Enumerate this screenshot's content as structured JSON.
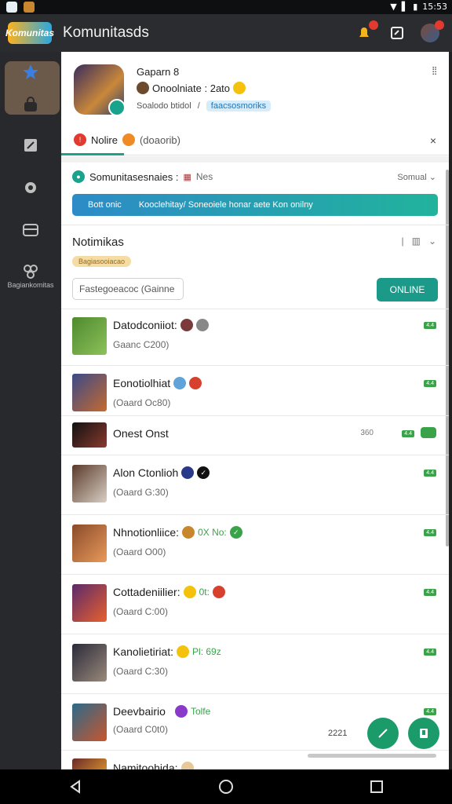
{
  "status": {
    "time": "15:53"
  },
  "appbar": {
    "logo": "Komunitas",
    "title": "Komunitasds"
  },
  "sidebar": {
    "items": [
      {
        "label": ""
      },
      {
        "label": ""
      },
      {
        "label": ""
      },
      {
        "label": ""
      },
      {
        "label": ""
      },
      {
        "label": "Bagiankomitas"
      }
    ]
  },
  "header": {
    "game_name": "Gaparn 8",
    "subtitle": "Onoolniate : 2ato",
    "meta": "Soalodo btidol",
    "meta_pill": "faacsosmoriks"
  },
  "tab": {
    "label": "Nolire",
    "extra": "(doaorib)"
  },
  "community": {
    "label": "Somunitasesnaies :",
    "sub": "Nes",
    "sort": "Somual",
    "banner_left": "Bott onic",
    "banner_right": "Kooclehitay/ Soneoiele honar aete Kon onilny"
  },
  "notif": {
    "title": "Notimikas",
    "tag": "Bagiasooiacao",
    "search_value": "Fastegoeacoc (Gainne",
    "online_button": "ONLINE"
  },
  "list": [
    {
      "name": "Datodconiiot:",
      "sub": "Gaanc C200)",
      "extra": "",
      "tag": "4.4"
    },
    {
      "name": "Eonotiolhiat",
      "sub": "(Oaard Oc80)",
      "extra": "",
      "tag": "4.4"
    },
    {
      "name": "Onest Onst",
      "sub": "",
      "extra": "360",
      "tag": "4.4"
    },
    {
      "name": "Alon Ctonlioh",
      "sub": "(Oaard G:30)",
      "extra": "",
      "tag": "4.4"
    },
    {
      "name": "Nhnotionliice:",
      "sub": "(Oaard O00)",
      "extra": "0X   No:",
      "tag": "4.4"
    },
    {
      "name": "Cottadeniilier:",
      "sub": "(Oaard C:00)",
      "extra": "0t:",
      "tag": "4.4"
    },
    {
      "name": "Kanolietiriat:",
      "sub": "(Oaard C:30)",
      "extra": "Pl: 69z",
      "tag": "4.4"
    },
    {
      "name": "Deevbairio",
      "sub": "(Oaard C0t0)",
      "extra": "Tolfe",
      "tag": "4.4"
    },
    {
      "name": "Namitoohida:",
      "sub": "",
      "extra": "",
      "tag": ""
    }
  ],
  "fab": {
    "counter": "2221"
  }
}
